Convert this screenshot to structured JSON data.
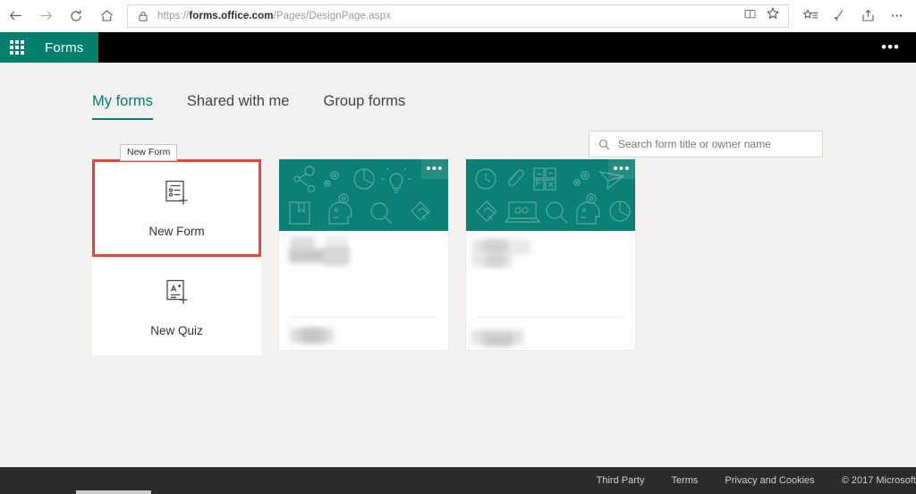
{
  "browser": {
    "back_icon": "back-arrow-icon",
    "forward_icon": "forward-arrow-icon",
    "refresh_icon": "refresh-icon",
    "home_icon": "home-icon",
    "lock_icon": "lock-icon",
    "url_scheme": "https://",
    "url_domain": "forms.office.com",
    "url_path": "/Pages/DesignPage.aspx",
    "reading_view_icon": "reading-view-icon",
    "favorite_icon": "star-icon",
    "reading_list_icon": "reading-list-icon",
    "web_note_icon": "pen-icon",
    "share_icon": "share-icon",
    "more_icon": "ellipsis-icon"
  },
  "app_header": {
    "waffle_label": "app-launcher",
    "brand": "Forms",
    "more_label": "•••"
  },
  "tabs": [
    {
      "label": "My forms",
      "active": true
    },
    {
      "label": "Shared with me",
      "active": false
    },
    {
      "label": "Group forms",
      "active": false
    }
  ],
  "search": {
    "placeholder": "Search form title or owner name",
    "value": ""
  },
  "new_items": [
    {
      "label": "New Form",
      "icon": "new-form-icon",
      "highlighted": true,
      "tooltip": "New Form"
    },
    {
      "label": "New Quiz",
      "icon": "new-quiz-icon",
      "highlighted": false
    }
  ],
  "form_cards": [
    {
      "menu_label": "•••",
      "banner_icons": [
        "network-icon",
        "gears-icon",
        "pie-chart-icon",
        "lightbulb-icon",
        "book-icon",
        "head-gear-icon",
        "magnifier-icon",
        "handshake-icon"
      ],
      "title_redacted": true,
      "meta_redacted": true
    },
    {
      "menu_label": "•••",
      "banner_icons": [
        "clock-icon",
        "paperclip-icon",
        "calculator-icon",
        "paper-plane-icon",
        "handshake-icon",
        "laptop-icon",
        "magnifier-icon",
        "head-gear-icon",
        "pie-chart-icon"
      ],
      "title_redacted": true,
      "meta_redacted": true
    }
  ],
  "footer": {
    "links": [
      "Third Party",
      "Terms",
      "Privacy and Cookies"
    ],
    "copyright": "© 2017 Microsoft"
  },
  "colors": {
    "brand_teal": "#00806c",
    "card_teal": "#0b8074",
    "highlight_red": "#e8453c",
    "page_bg": "#f3f2f1",
    "header_black": "#000000",
    "footer_dark": "#2b2b2b"
  }
}
